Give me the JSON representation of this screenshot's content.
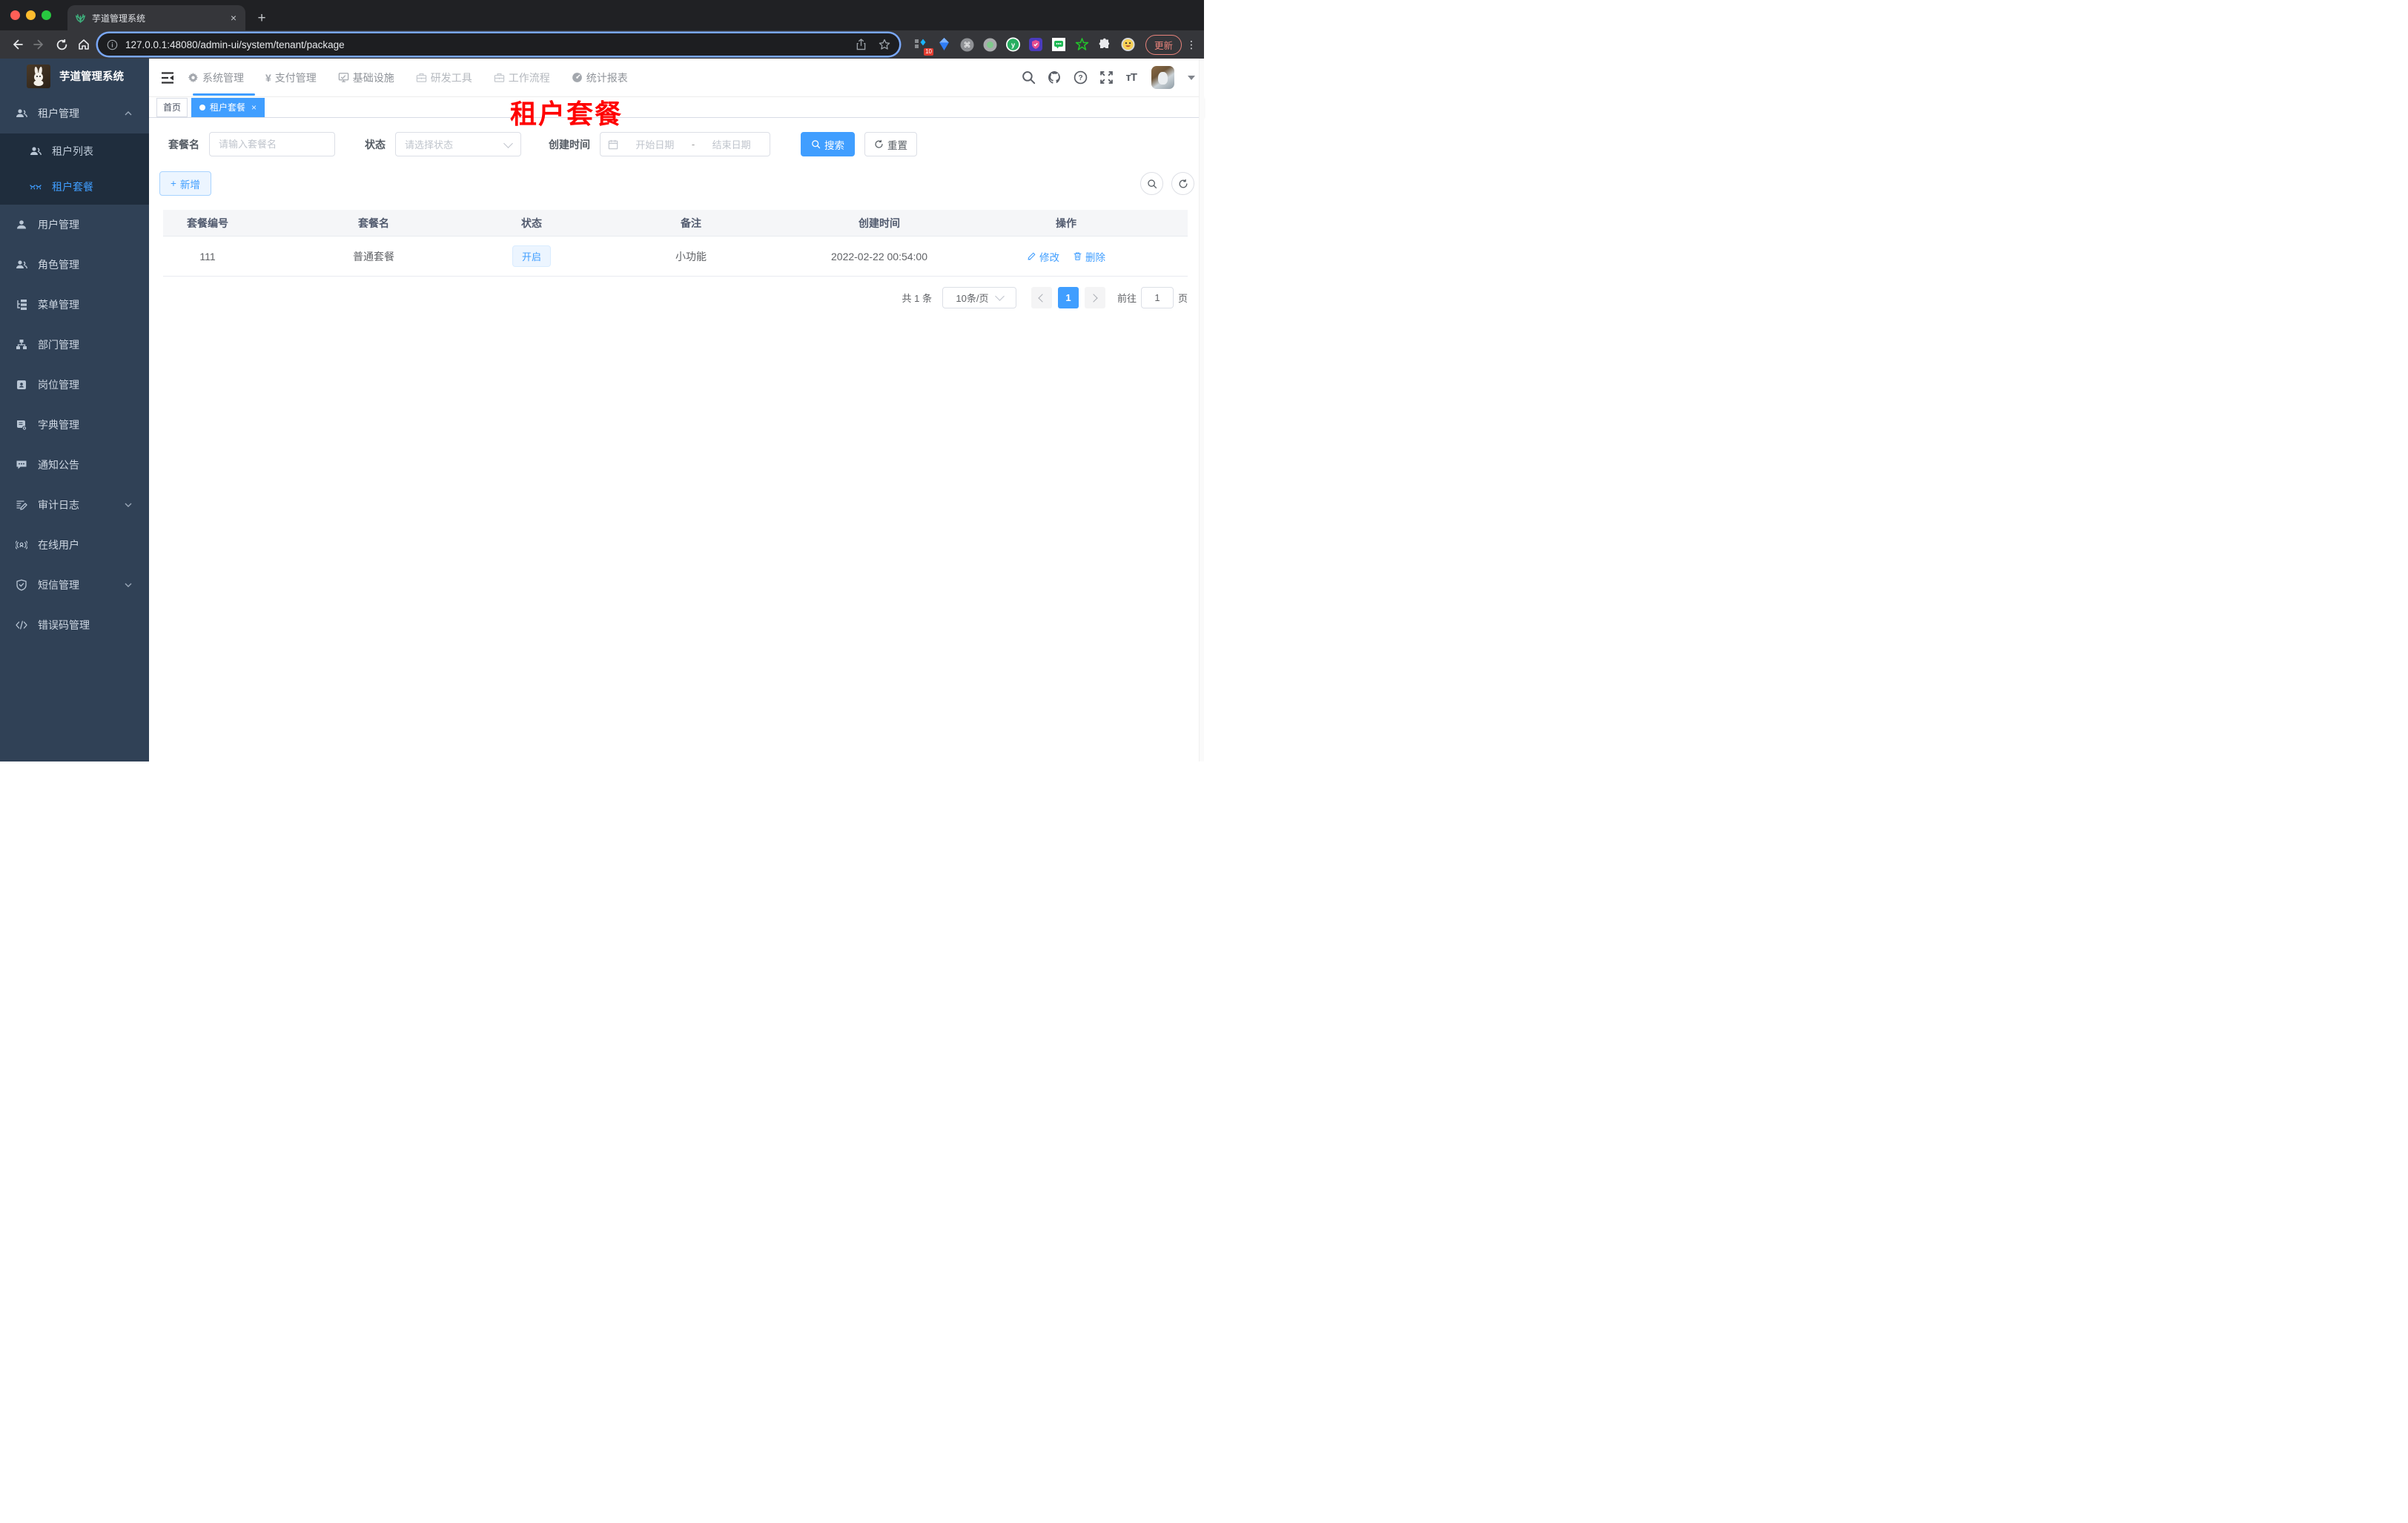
{
  "browser": {
    "tab_title": "芋道管理系统",
    "url": "127.0.0.1:48080/admin-ui/system/tenant/package",
    "update_label": "更新",
    "extension_badge": "10",
    "new_tab_icon": "+",
    "close_icon": "×"
  },
  "sidebar": {
    "logo_title": "芋道管理系统",
    "items": [
      {
        "label": "租户管理"
      },
      {
        "label": "租户列表"
      },
      {
        "label": "租户套餐"
      },
      {
        "label": "用户管理"
      },
      {
        "label": "角色管理"
      },
      {
        "label": "菜单管理"
      },
      {
        "label": "部门管理"
      },
      {
        "label": "岗位管理"
      },
      {
        "label": "字典管理"
      },
      {
        "label": "通知公告"
      },
      {
        "label": "审计日志"
      },
      {
        "label": "在线用户"
      },
      {
        "label": "短信管理"
      },
      {
        "label": "错误码管理"
      }
    ]
  },
  "topnav": {
    "items": [
      {
        "label": "系统管理"
      },
      {
        "label": "支付管理"
      },
      {
        "label": "基础设施"
      },
      {
        "label": "研发工具"
      },
      {
        "label": "工作流程"
      },
      {
        "label": "统计报表"
      }
    ],
    "yen_glyph": "¥",
    "text_size_glyph": "тT",
    "help_glyph": "?"
  },
  "tags": [
    {
      "label": "首页"
    },
    {
      "label": "租户套餐"
    }
  ],
  "page_title": "租户套餐",
  "filters": {
    "package_name_label": "套餐名",
    "package_name_placeholder": "请输入套餐名",
    "status_label": "状态",
    "status_placeholder": "请选择状态",
    "create_time_label": "创建时间",
    "start_date_placeholder": "开始日期",
    "date_separator": "-",
    "end_date_placeholder": "结束日期",
    "search_label": "搜索",
    "reset_label": "重置"
  },
  "toolbar": {
    "add_label": "新增",
    "plus_glyph": "+"
  },
  "table": {
    "columns": [
      "套餐编号",
      "套餐名",
      "状态",
      "备注",
      "创建时间",
      "操作"
    ],
    "rows": [
      {
        "id": "111",
        "name": "普通套餐",
        "status": "开启",
        "remark": "小功能",
        "create_time": "2022-02-22 00:54:00",
        "edit_label": "修改",
        "delete_label": "删除"
      }
    ]
  },
  "pagination": {
    "total_label": "共 1 条",
    "page_size": "10条/页",
    "current_page": "1",
    "goto_label": "前往",
    "goto_value": "1",
    "page_label": "页"
  },
  "colors": {
    "accent": "#409eff",
    "sidebar_bg": "#304156",
    "submenu_bg": "#1f2d3d",
    "title_red": "#ff0000",
    "tag_active_bg": "#409eff"
  }
}
